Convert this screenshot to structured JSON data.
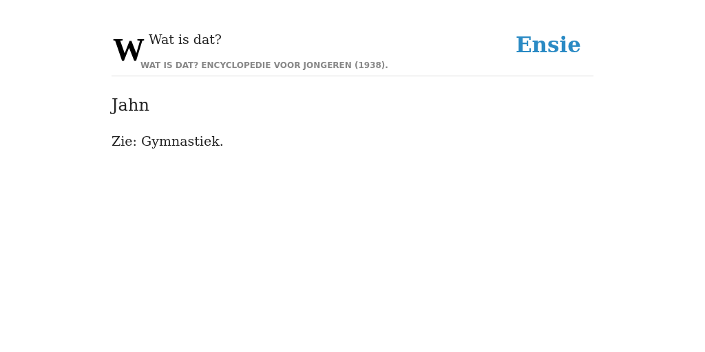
{
  "header": {
    "logo": "W",
    "site_title": "Wat is dat?",
    "subtitle": "WAT IS DAT? ENCYCLOPEDIE VOOR JONGEREN (1938).",
    "brand": "Ensie"
  },
  "article": {
    "title": "Jahn",
    "body": "Zie: Gymnastiek."
  }
}
